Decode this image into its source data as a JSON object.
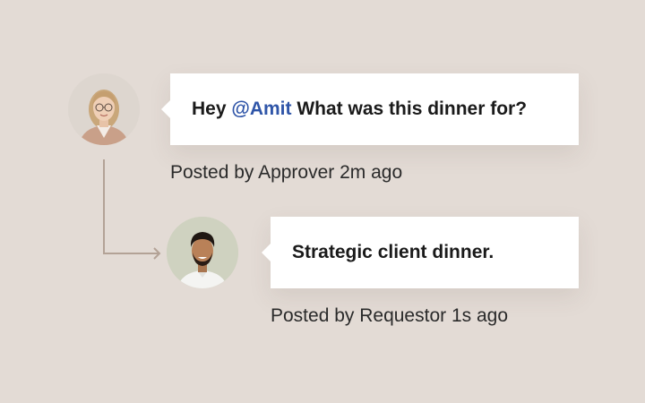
{
  "thread": {
    "comments": [
      {
        "author": "Approver",
        "text_before": "Hey ",
        "mention": "@Amit",
        "text_after": " What was this dinner for?",
        "meta": "Posted by Approver 2m ago"
      },
      {
        "author": "Requestor",
        "text": "Strategic client dinner.",
        "meta": "Posted by Requestor 1s ago"
      }
    ]
  },
  "colors": {
    "background": "#e3dbd5",
    "mention": "#2f55a8",
    "connector": "#b3a296"
  }
}
